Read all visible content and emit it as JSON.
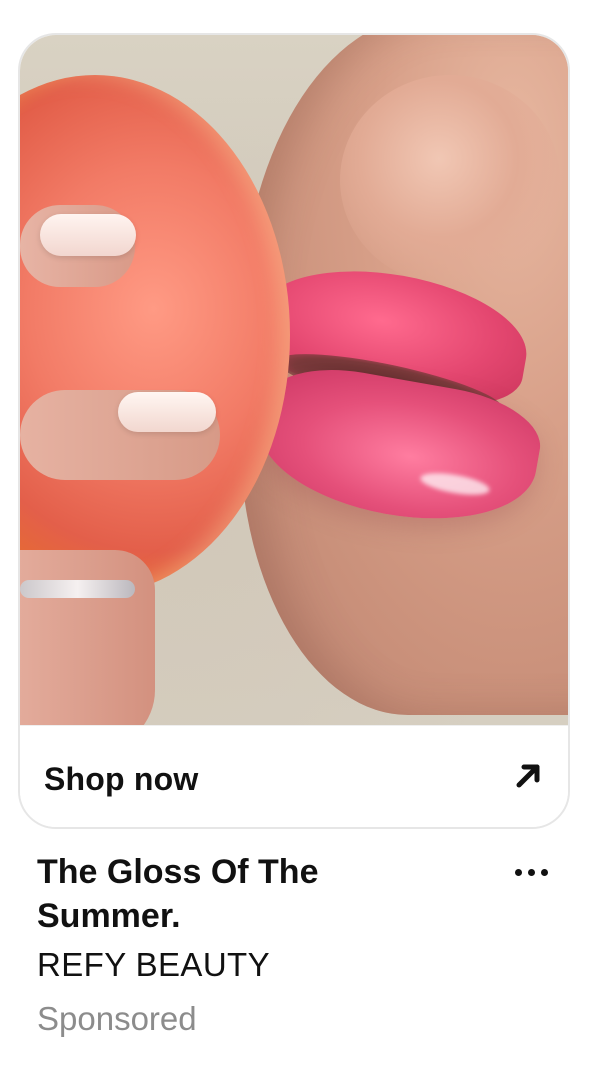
{
  "pin": {
    "cta_label": "Shop now",
    "cta_icon": "arrow-up-right-icon",
    "title": "The Gloss Of The Summer.",
    "brand": "REFY BEAUTY",
    "sponsored_label": "Sponsored",
    "more_icon": "more-options-icon"
  }
}
